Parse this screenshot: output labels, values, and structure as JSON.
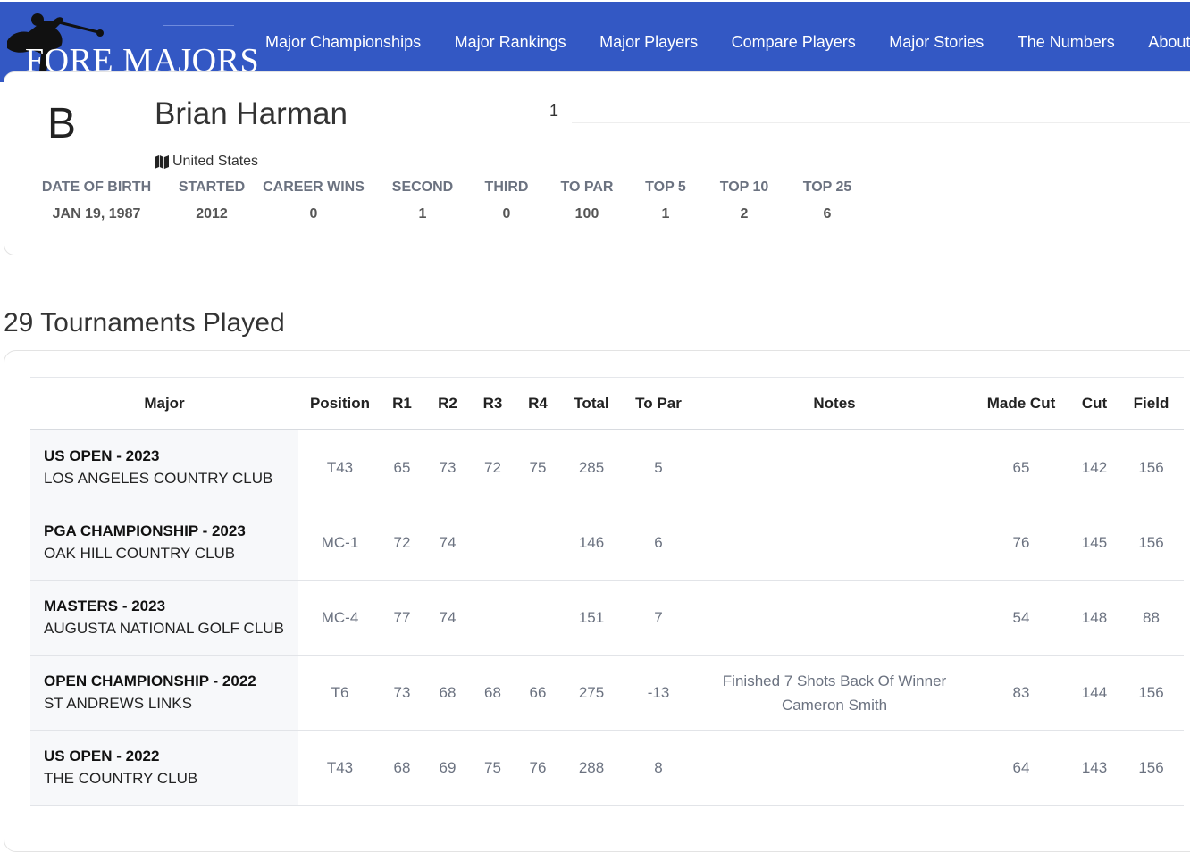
{
  "nav": {
    "logo_text": "FORE MAJORS",
    "items": [
      "Major Championships",
      "Major Rankings",
      "Major Players",
      "Compare Players",
      "Major Stories",
      "The Numbers",
      "About"
    ]
  },
  "player": {
    "initial": "B",
    "name": "Brian Harman",
    "rank": "1",
    "country": "United States"
  },
  "stats": [
    {
      "label": "DATE OF BIRTH",
      "value": "JAN 19, 1987"
    },
    {
      "label": "STARTED",
      "value": "2012"
    },
    {
      "label": "CAREER WINS",
      "value": "0"
    },
    {
      "label": "SECOND",
      "value": "1"
    },
    {
      "label": "THIRD",
      "value": "0"
    },
    {
      "label": "TO PAR",
      "value": "100"
    },
    {
      "label": "TOP 5",
      "value": "1"
    },
    {
      "label": "TOP 10",
      "value": "2"
    },
    {
      "label": "TOP 25",
      "value": "6"
    }
  ],
  "section_title": "29 Tournaments Played",
  "table": {
    "headers": [
      "Major",
      "Position",
      "R1",
      "R2",
      "R3",
      "R4",
      "Total",
      "To Par",
      "Notes",
      "Made Cut",
      "Cut",
      "Field"
    ],
    "rows": [
      {
        "major": "US OPEN - 2023",
        "venue": "LOS ANGELES COUNTRY CLUB",
        "position": "T43",
        "r1": "65",
        "r2": "73",
        "r3": "72",
        "r4": "75",
        "total": "285",
        "to_par": "5",
        "notes": "",
        "made_cut": "65",
        "cut": "142",
        "field": "156"
      },
      {
        "major": "PGA CHAMPIONSHIP - 2023",
        "venue": "OAK HILL COUNTRY CLUB",
        "position": "MC-1",
        "r1": "72",
        "r2": "74",
        "r3": "",
        "r4": "",
        "total": "146",
        "to_par": "6",
        "notes": "",
        "made_cut": "76",
        "cut": "145",
        "field": "156"
      },
      {
        "major": "MASTERS - 2023",
        "venue": "AUGUSTA NATIONAL GOLF CLUB",
        "position": "MC-4",
        "r1": "77",
        "r2": "74",
        "r3": "",
        "r4": "",
        "total": "151",
        "to_par": "7",
        "notes": "",
        "made_cut": "54",
        "cut": "148",
        "field": "88"
      },
      {
        "major": "OPEN CHAMPIONSHIP - 2022",
        "venue": "ST ANDREWS LINKS",
        "position": "T6",
        "r1": "73",
        "r2": "68",
        "r3": "68",
        "r4": "66",
        "total": "275",
        "to_par": "-13",
        "notes": "Finished 7 Shots Back Of Winner Cameron Smith",
        "made_cut": "83",
        "cut": "144",
        "field": "156"
      },
      {
        "major": "US OPEN - 2022",
        "venue": "THE COUNTRY CLUB",
        "position": "T43",
        "r1": "68",
        "r2": "69",
        "r3": "75",
        "r4": "76",
        "total": "288",
        "to_par": "8",
        "notes": "",
        "made_cut": "64",
        "cut": "143",
        "field": "156"
      }
    ]
  }
}
